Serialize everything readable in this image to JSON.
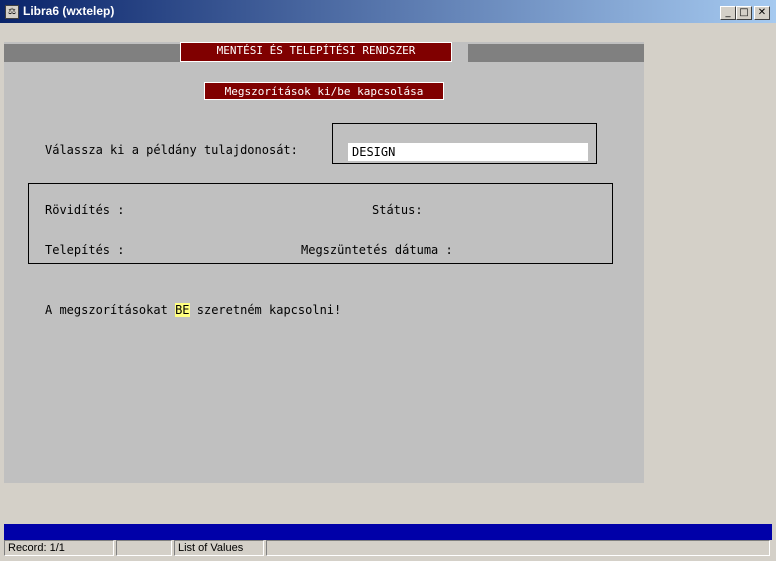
{
  "window": {
    "title": "Libra6 (wxtelep)",
    "icon_text": "⚖",
    "minimize_glyph": "_",
    "maximize_glyph": "□",
    "close_glyph": "✕"
  },
  "form": {
    "system_title": "MENTÉSI ÉS TELEPÍTÉSI RENDSZER",
    "subtitle": "Megszorítások ki/be kapcsolása",
    "owner_prompt": "Válassza ki a példány tulajdonosát:",
    "owner_value": "DESIGN",
    "fields": {
      "abbreviation_label": "Rövidítés :",
      "status_label": "Státus:",
      "install_label": "Telepítés :",
      "termination_label": "Megszüntetés dátuma :"
    },
    "action": {
      "prefix": "A megszorításokat",
      "toggle_value": "BE",
      "suffix": "szeretném kapcsolni!"
    }
  },
  "statusbar": {
    "record": "Record: 1/1",
    "cell2": "",
    "lov": "List of Values",
    "cell4": ""
  },
  "colors": {
    "titlebar_start": "#0a246a",
    "form_background": "#c0c0c0",
    "banner_red": "#800000",
    "highlight_yellow": "#ffff80",
    "status_blue": "#0000a8"
  }
}
